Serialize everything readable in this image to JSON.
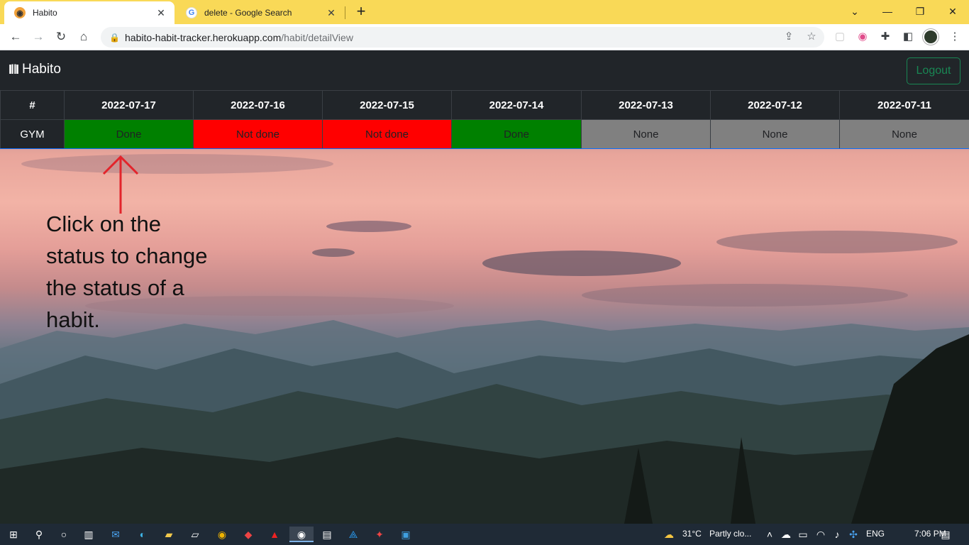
{
  "browser": {
    "tabs": [
      {
        "title": "Habito",
        "favicon": "habito-favicon",
        "active": true
      },
      {
        "title": "delete - Google Search",
        "favicon": "google-favicon",
        "active": false
      }
    ],
    "url_host": "habito-habit-tracker.herokuapp.com",
    "url_path": "/habit/detailView",
    "tab_strip_color": "#f9d957"
  },
  "app": {
    "brand": "Habito",
    "logout_label": "Logout",
    "navbar_color": "#212529",
    "accent_success": "#198754"
  },
  "table": {
    "corner_header": "#",
    "dates": [
      "2022-07-17",
      "2022-07-16",
      "2022-07-15",
      "2022-07-14",
      "2022-07-13",
      "2022-07-12",
      "2022-07-11"
    ],
    "rows": [
      {
        "habit": "GYM",
        "statuses": [
          "Done",
          "Not done",
          "Not done",
          "Done",
          "None",
          "None",
          "None"
        ]
      }
    ],
    "status_colors": {
      "Done": "#008000",
      "Not done": "#ff0000",
      "None": "#808080"
    }
  },
  "annotation": {
    "text_lines": [
      "Click on the",
      "status to change",
      "the status of a",
      "habit."
    ],
    "arrow_color": "#e3242b"
  },
  "taskbar": {
    "weather_temp": "31°C",
    "weather_desc": "Partly clo...",
    "language": "ENG",
    "time": "7:06 PM"
  }
}
